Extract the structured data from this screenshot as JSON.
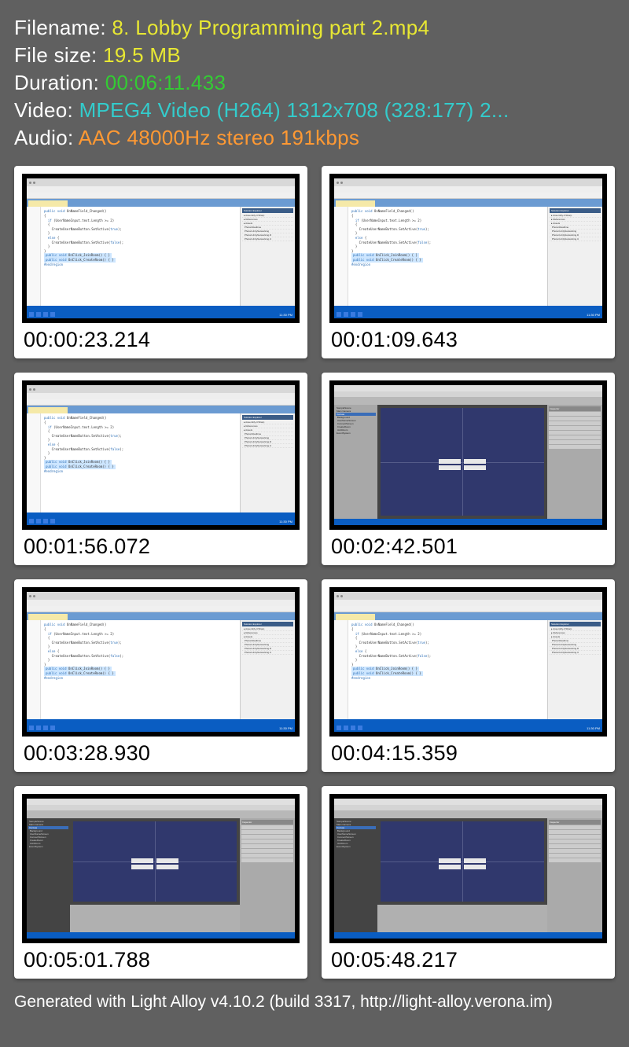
{
  "info": {
    "filename_label": "Filename: ",
    "filename_value": "8. Lobby Programming part 2.mp4",
    "filesize_label": "File size: ",
    "filesize_value": "19.5 MB",
    "duration_label": "Duration: ",
    "duration_value": "00:06:11.433",
    "video_label": "Video: ",
    "video_value": "MPEG4 Video (H264) 1312x708 (328:177) 2...",
    "audio_label": "Audio: ",
    "audio_value": "AAC 48000Hz stereo 191kbps"
  },
  "thumbnails": [
    {
      "time": "00:00:23.214",
      "type": "vs"
    },
    {
      "time": "00:01:09.643",
      "type": "vs"
    },
    {
      "time": "00:01:56.072",
      "type": "vs"
    },
    {
      "time": "00:02:42.501",
      "type": "unity"
    },
    {
      "time": "00:03:28.930",
      "type": "vs"
    },
    {
      "time": "00:04:15.359",
      "type": "vs"
    },
    {
      "time": "00:05:01.788",
      "type": "unity-dark"
    },
    {
      "time": "00:05:48.217",
      "type": "unity-dark"
    }
  ],
  "footer": "Generated with Light Alloy v4.10.2 (build 3317, http://light-alloy.verona.im)"
}
